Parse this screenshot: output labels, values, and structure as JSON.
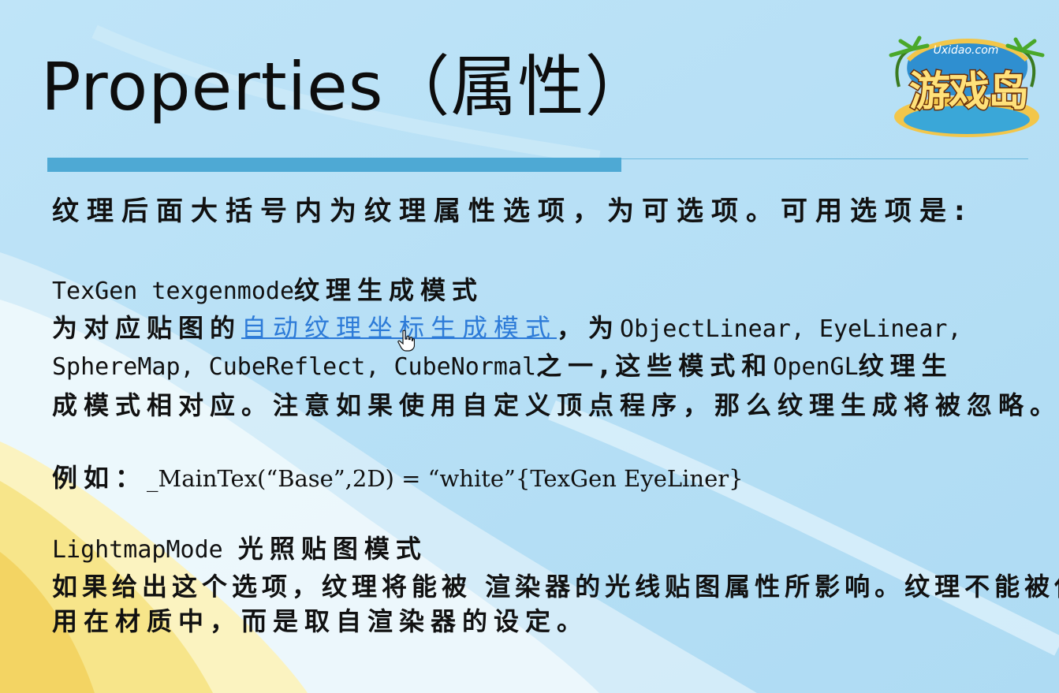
{
  "slide": {
    "title": "Properties（属性）",
    "intro": "纹理后面大括号内为纹理属性选项，为可选项。可用选项是:",
    "texgen": {
      "heading_code": "TexGen texgenmode",
      "heading_label": "纹理生成模式",
      "line1_prefix": "为对应贴图的",
      "line1_link": "自动纹理坐标生成模式",
      "line1_comma": "，为",
      "line1_code": "ObjectLinear, EyeLinear,",
      "line2_code": "SphereMap, CubeReflect, CubeNormal",
      "line2_text1": "之一,这些模式和",
      "line2_code2": "OpenGL",
      "line2_text2": "纹理生",
      "line3": "成模式相对应。注意如果使用自定义顶点程序，那么纹理生成将被忽略。"
    },
    "example": {
      "label": "例如：",
      "code": "_MainTex(“Base”,2D) = “white”{TexGen EyeLiner}"
    },
    "lightmap": {
      "heading_code": "LightmapMode",
      "heading_label": " 光照贴图模式",
      "line1": "如果给出这个选项，纹理将能被 渲染器的光线贴图属性所影响。纹理不能被使",
      "line2": "用在材质中，而是取自渲染器的设定。"
    }
  },
  "logo": {
    "site": "Uxidao.com",
    "name": "游戏岛"
  },
  "colors": {
    "background": "#b9e1f6",
    "accent_bar": "#4ea9d4",
    "link": "#2d7bd8",
    "sand": "#f7e58a"
  },
  "icons": {
    "cursor": "hand-pointer-icon"
  }
}
